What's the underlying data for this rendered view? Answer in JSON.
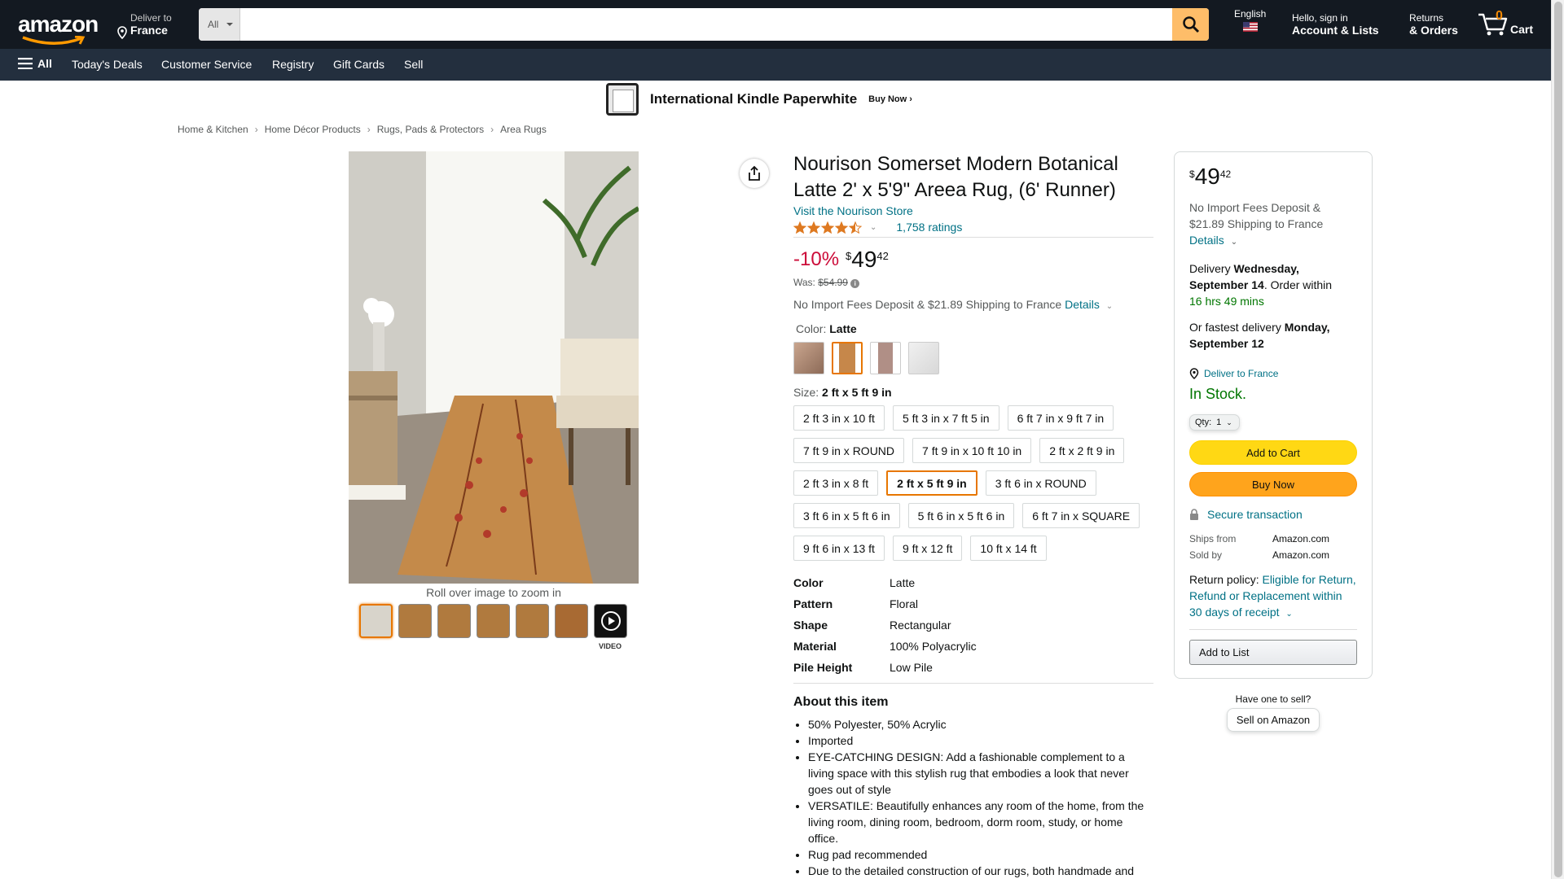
{
  "nav": {
    "logo_text": "amazon",
    "deliver_line1": "Deliver to",
    "deliver_line2": "France",
    "search_dept": "All",
    "search_placeholder": "",
    "language": "English",
    "account_line1": "Hello, sign in",
    "account_line2": "Account & Lists",
    "returns_line1": "Returns",
    "returns_line2": "& Orders",
    "cart_count": "0",
    "cart_label": "Cart"
  },
  "subnav": {
    "all_label": "All",
    "items": [
      "Today's Deals",
      "Customer Service",
      "Registry",
      "Gift Cards",
      "Sell"
    ]
  },
  "banner": {
    "title": "International Kindle Paperwhite",
    "cta": "Buy Now ›"
  },
  "breadcrumbs": [
    "Home & Kitchen",
    "Home Décor Products",
    "Rugs, Pads & Protectors",
    "Area Rugs"
  ],
  "gallery": {
    "zoom_hint": "Roll over image to zoom in",
    "video_label": "VIDEO"
  },
  "product": {
    "title": "Nourison Somerset Modern Botanical Latte 2' x 5'9\" Areea Rug, (6' Runner)",
    "store_link": "Visit the Nourison Store",
    "rating_stars": 4.5,
    "ratings_count": "1,758 ratings",
    "discount": "-10%",
    "price_symbol": "$",
    "price_whole": "49",
    "price_fraction": "42",
    "was_label": "Was:",
    "was_price": "$54.99",
    "import_text": "No Import Fees Deposit & $21.89 Shipping to France",
    "details_link": "Details",
    "color_label": "Color:",
    "color_value": "Latte",
    "size_label": "Size:",
    "size_value": "2 ft x 5 ft 9 in",
    "sizes": [
      "2 ft 3 in x 10 ft",
      "5 ft 3 in x 7 ft 5 in",
      "6 ft 7 in x 9 ft 7 in",
      "7 ft 9 in x ROUND",
      "7 ft 9 in x 10 ft 10 in",
      "2 ft x 2 ft 9 in",
      "2 ft 3 in x 8 ft",
      "2 ft x 5 ft 9 in",
      "3 ft 6 in x ROUND",
      "3 ft 6 in x 5 ft 6 in",
      "5 ft 6 in x 5 ft 6 in",
      "6 ft 7 in x SQUARE",
      "9 ft 6 in x 13 ft",
      "9 ft x 12 ft",
      "10 ft x 14 ft"
    ],
    "selected_size_index": 7,
    "specs": [
      {
        "k": "Color",
        "v": "Latte"
      },
      {
        "k": "Pattern",
        "v": "Floral"
      },
      {
        "k": "Shape",
        "v": "Rectangular"
      },
      {
        "k": "Material",
        "v": "100% Polyacrylic"
      },
      {
        "k": "Pile Height",
        "v": "Low Pile"
      }
    ],
    "about_title": "About this item",
    "about": [
      "50% Polyester, 50% Acrylic",
      "Imported",
      "EYE-CATCHING DESIGN: Add a fashionable complement to a living space with this stylish rug that embodies a look that never goes out of style",
      "VERSATILE: Beautifully enhances any room of the home, from the living room, dining room, bedroom, dorm room, study, or home office.",
      "Rug pad recommended",
      "Due to the detailed construction of our rugs, both handmade and"
    ]
  },
  "buybox": {
    "price_symbol": "$",
    "price_whole": "49",
    "price_fraction": "42",
    "import_text": "No Import Fees Deposit & $21.89 Shipping to France",
    "details_link": "Details",
    "delivery_prefix": "Delivery",
    "delivery_date": "Wednesday, September 14",
    "order_within": ". Order within",
    "countdown": "16 hrs 49 mins",
    "fastest_prefix": "Or fastest delivery",
    "fastest_date": "Monday, September 12",
    "deliver_to": "Deliver to France",
    "stock": "In Stock.",
    "qty_label": "Qty:",
    "qty_value": "1",
    "add_to_cart": "Add to Cart",
    "buy_now": "Buy Now",
    "secure": "Secure transaction",
    "ships_from_label": "Ships from",
    "ships_from": "Amazon.com",
    "sold_by_label": "Sold by",
    "sold_by": "Amazon.com",
    "return_label": "Return policy:",
    "return_link": "Eligible for Return, Refund or Replacement within 30 days of receipt",
    "add_to_list": "Add to List"
  },
  "sell": {
    "question": "Have one to sell?",
    "button": "Sell on Amazon"
  },
  "colors": {
    "nav_bg": "#131921",
    "subnav_bg": "#232f3e",
    "search_button": "#febd69",
    "discount_red": "#cc0c39",
    "link": "#007185",
    "in_stock_green": "#007600",
    "add_to_cart": "#ffd814",
    "buy_now": "#ffa41c",
    "select_orange": "#e77600",
    "star": "#de7921"
  }
}
